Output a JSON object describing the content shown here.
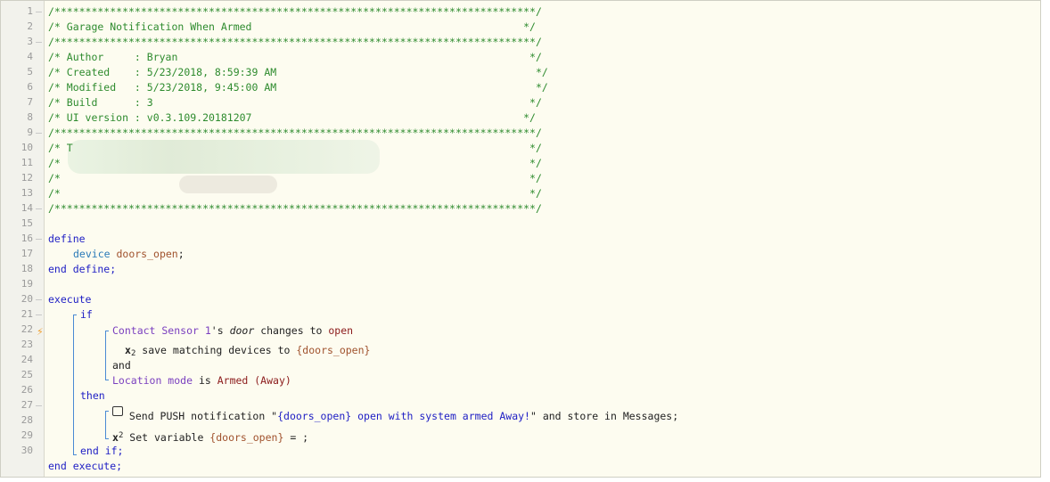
{
  "line_numbers": [
    "1",
    "2",
    "3",
    "4",
    "5",
    "6",
    "7",
    "8",
    "9",
    "10",
    "11",
    "12",
    "13",
    "14",
    "15",
    "16",
    "17",
    "18",
    "19",
    "20",
    "21",
    "22",
    "23",
    "24",
    "25",
    "26",
    "27",
    "28",
    "29",
    "30"
  ],
  "header": {
    "star_line": "/******************************************************************************/",
    "title": "/* Garage Notification When Armed                                            */",
    "author": "/* Author     : Bryan                                                         */",
    "created": "/* Created    : 5/23/2018, 8:59:39 AM                                          */",
    "modified": "/* Modified   : 5/23/2018, 9:45:00 AM                                          */",
    "build": "/* Build      : 3                                                             */",
    "ui_version": "/* UI version : v0.3.109.20181207                                            */",
    "redacted_1": "/* T                                                                          */",
    "redacted_2": "/*                                                                            */",
    "redacted_3": "/*                                                                            */",
    "redacted_4": "/*                                                                            */"
  },
  "code": {
    "define": "define",
    "device_kw": "device",
    "device_var": "doors_open",
    "semicolon": ";",
    "end_define": "end define;",
    "execute": "execute",
    "if_kw": "if",
    "cond1_device": "Contact Sensor 1",
    "cond1_s": "'s ",
    "cond1_attr": "door",
    "cond1_changes": " changes to ",
    "cond1_value": "open",
    "save_sub": "2",
    "save_text": " save matching devices to ",
    "save_var": "{doors_open}",
    "and_kw": "and",
    "cond2_device": "Location mode",
    "cond2_is": " is ",
    "cond2_value": "Armed (Away)",
    "then_kw": "then",
    "push_pre": " Send PUSH notification \"",
    "push_msg": "{doors_open} open with system armed Away!",
    "push_post": "\" and store in Messages;",
    "setvar_sup": "2",
    "setvar_text": " Set variable ",
    "setvar_var": "{doors_open}",
    "setvar_post": " = ;",
    "end_if": "end if;",
    "end_execute": "end execute;",
    "x_glyph": "x"
  }
}
